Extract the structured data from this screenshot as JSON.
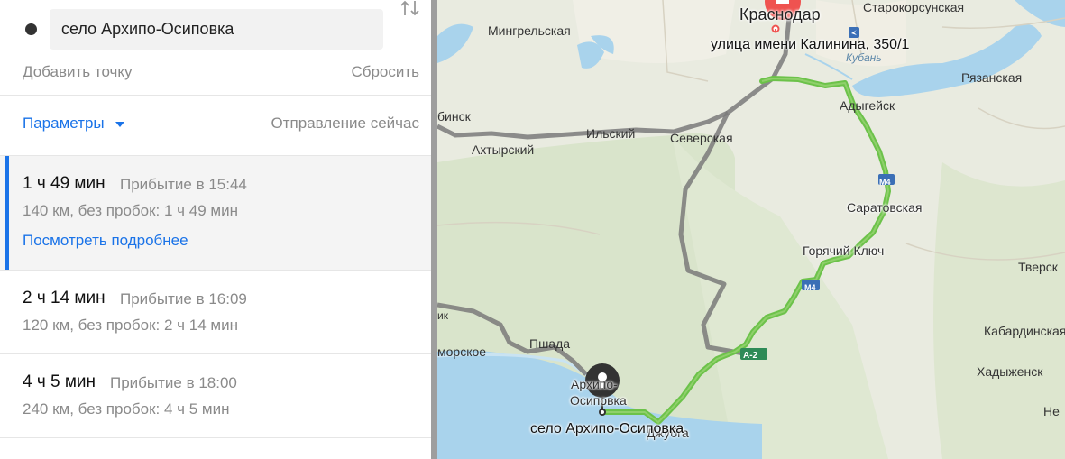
{
  "route_panel": {
    "waypoint": "село Архипо-Осиповка",
    "add_point": "Добавить точку",
    "reset": "Сбросить",
    "parameters": "Параметры",
    "departure": "Отправление сейчас",
    "routes": [
      {
        "duration": "1 ч 49 мин",
        "arrival": "Прибытие в 15:44",
        "info": "140 км, без пробок: 1 ч 49 мин",
        "details": "Посмотреть подробнее",
        "selected": true
      },
      {
        "duration": "2 ч 14 мин",
        "arrival": "Прибытие в 16:09",
        "info": "120 км, без пробок: 2 ч 14 мин",
        "selected": false
      },
      {
        "duration": "4 ч 5 мин",
        "arrival": "Прибытие в 18:00",
        "info": "240 км, без пробок: 4 ч 5 мин",
        "selected": false
      }
    ]
  },
  "map": {
    "start_label": "улица имени Калинина, 350/1",
    "end_label": "село Архипо-Осиповка",
    "places": {
      "krasnodar": "Краснодар",
      "starokorsunskaya": "Старокорсунская",
      "mingrelskaya": "Мингрельская",
      "kuban": "Кубань",
      "ryazanskaya": "Рязанская",
      "adygeysk": "Адыгейск",
      "binsk": "бинск",
      "akhtyrsky": "Ахтырский",
      "ilsky": "Ильский",
      "severskaya": "Северская",
      "saratovskaya": "Саратовская",
      "goryachy_klyuch": "Горячий Ключ",
      "tverskaya": "Тверск",
      "kabardinskaya": "Кабардинская",
      "khadyzhensk": "Хадыженск",
      "neftegorsk": "Не",
      "morskoe": "морское",
      "pshada": "Пшада",
      "arkhipo_osipovka_1": "Архипо-",
      "arkhipo_osipovka_2": "Осиповка",
      "dzhubga": "Джубга",
      "road_m4_a": "М4",
      "road_m4_b": "М4",
      "road_a289": "А-2",
      "road_r2": "2",
      "ik": "ик"
    },
    "colors": {
      "route_main": "#6cc24a",
      "route_alt": "#9b9b9b",
      "sea": "#a9d3ec",
      "accent": "#1a73e8",
      "start_marker": "#ef5350"
    }
  }
}
